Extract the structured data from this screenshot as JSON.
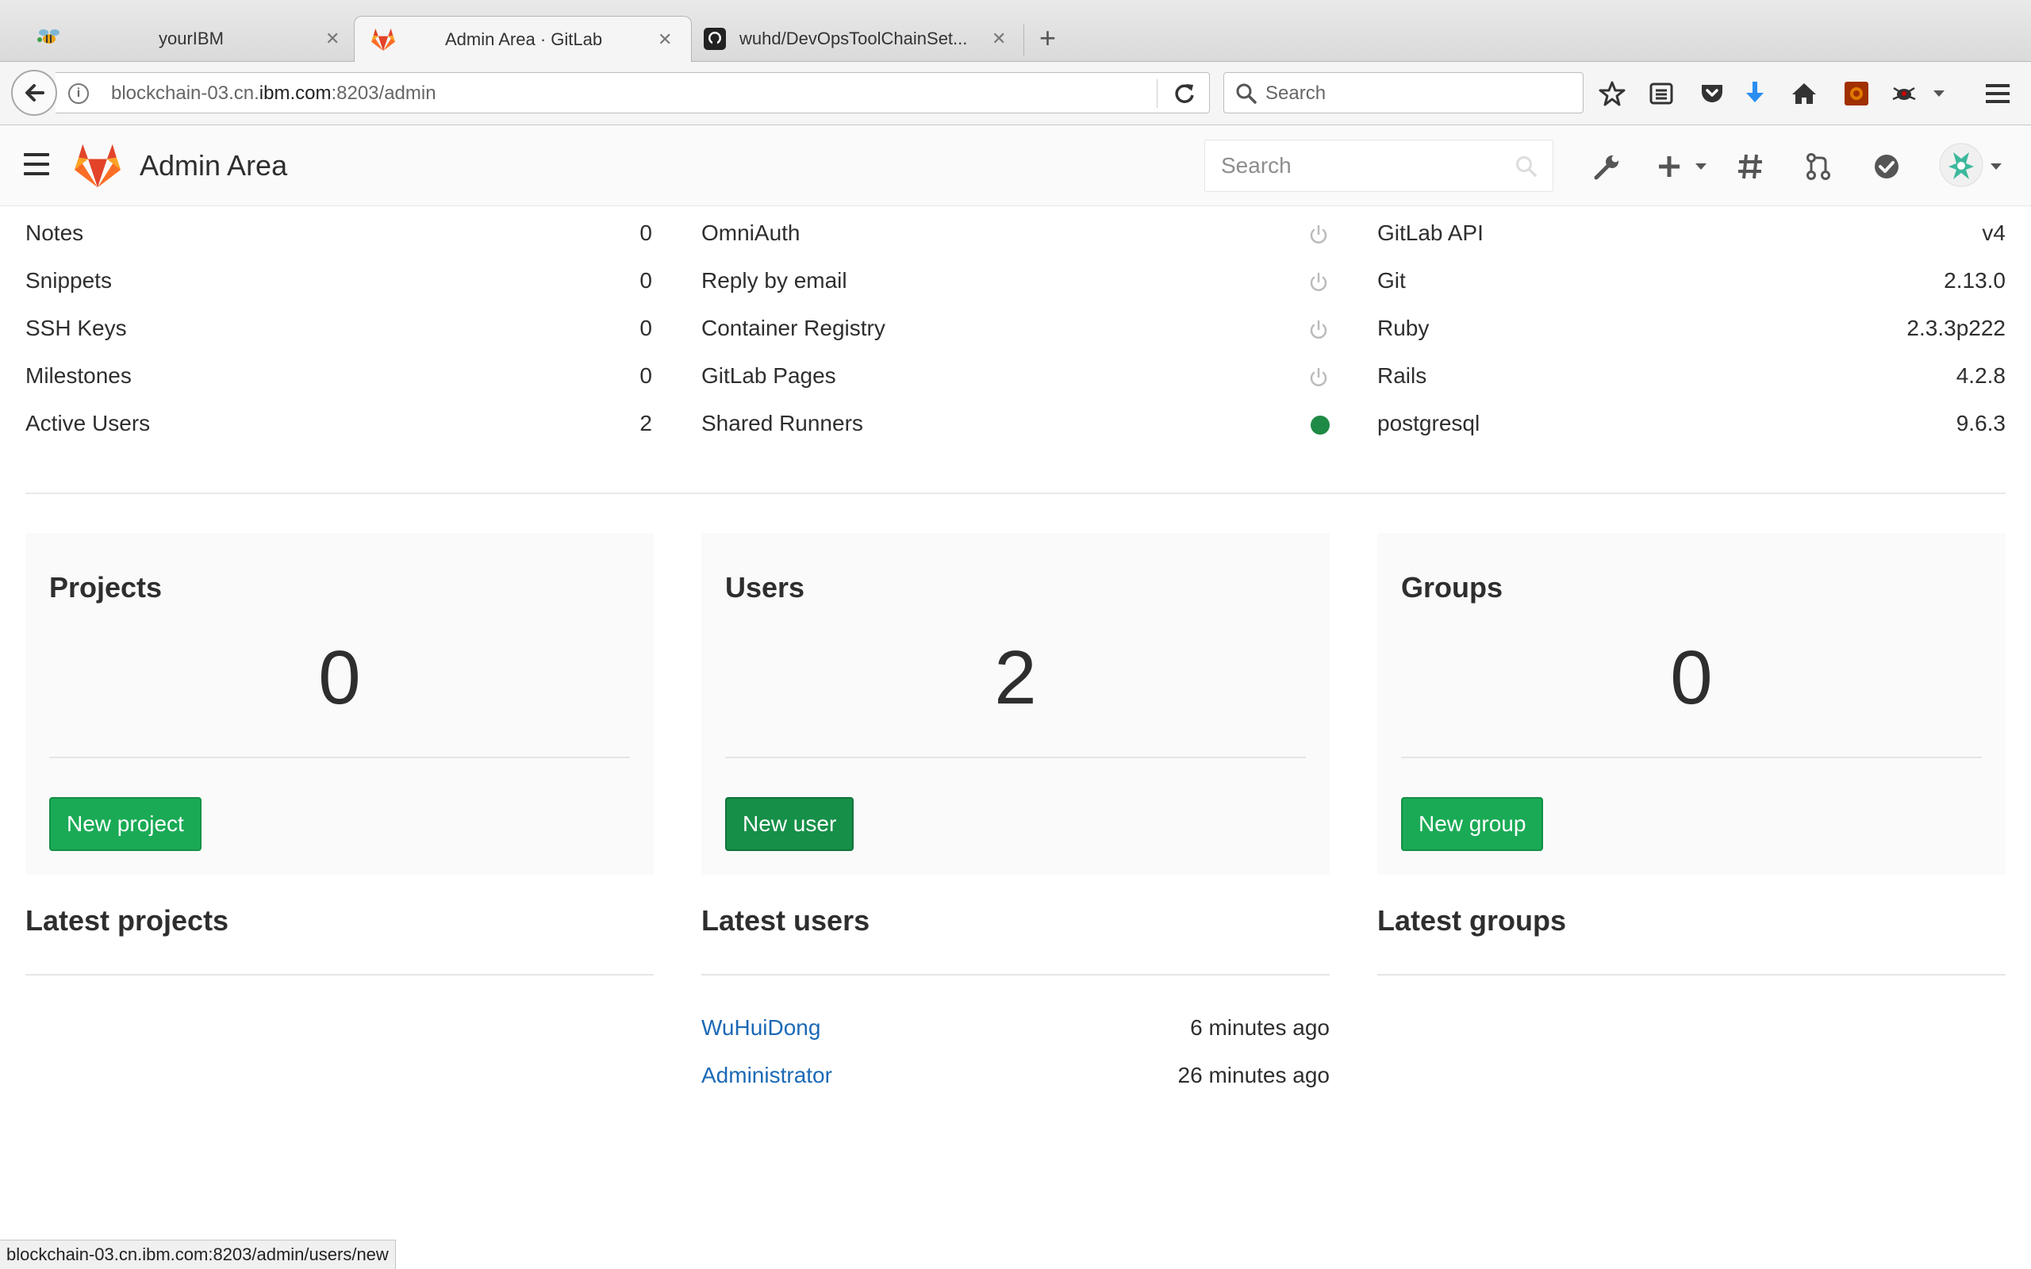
{
  "browser": {
    "tabs": [
      {
        "title": "yourIBM",
        "icon": "ibm-bee-icon"
      },
      {
        "title": "Admin Area · GitLab",
        "icon": "gitlab-tanuki-icon"
      },
      {
        "title": "wuhd/DevOpsToolChainSet...",
        "icon": "github-icon"
      }
    ],
    "url_prefix": "blockchain-03.cn.",
    "url_domain": "ibm.com",
    "url_suffix": ":8203/admin",
    "search_placeholder": "Search",
    "status_url": "blockchain-03.cn.ibm.com:8203/admin/users/new"
  },
  "header": {
    "title": "Admin Area",
    "search_placeholder": "Search"
  },
  "stats": {
    "counts": [
      {
        "label": "Notes",
        "value": "0"
      },
      {
        "label": "Snippets",
        "value": "0"
      },
      {
        "label": "SSH Keys",
        "value": "0"
      },
      {
        "label": "Milestones",
        "value": "0"
      },
      {
        "label": "Active Users",
        "value": "2"
      }
    ],
    "features": [
      {
        "label": "OmniAuth",
        "enabled": false
      },
      {
        "label": "Reply by email",
        "enabled": false
      },
      {
        "label": "Container Registry",
        "enabled": false
      },
      {
        "label": "GitLab Pages",
        "enabled": false
      },
      {
        "label": "Shared Runners",
        "enabled": true
      }
    ],
    "components": [
      {
        "label": "GitLab API",
        "value": "v4"
      },
      {
        "label": "Git",
        "value": "2.13.0"
      },
      {
        "label": "Ruby",
        "value": "2.3.3p222"
      },
      {
        "label": "Rails",
        "value": "4.2.8"
      },
      {
        "label": "postgresql",
        "value": "9.6.3"
      }
    ]
  },
  "boxes": {
    "projects": {
      "title": "Projects",
      "count": "0",
      "button": "New project"
    },
    "users": {
      "title": "Users",
      "count": "2",
      "button": "New user"
    },
    "groups": {
      "title": "Groups",
      "count": "0",
      "button": "New group"
    }
  },
  "latest": {
    "projects_title": "Latest projects",
    "users_title": "Latest users",
    "groups_title": "Latest groups",
    "users": [
      {
        "name": "WuHuiDong",
        "time": "6 minutes ago"
      },
      {
        "name": "Administrator",
        "time": "26 minutes ago"
      }
    ]
  },
  "colors": {
    "accent_green": "#1aaa55",
    "link_blue": "#1b69b6",
    "enabled_dot": "#1f8a45"
  }
}
